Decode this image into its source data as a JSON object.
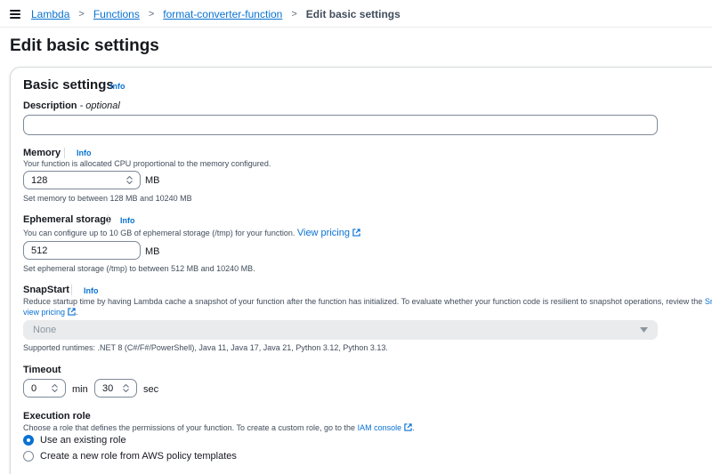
{
  "breadcrumb": {
    "items": [
      "Lambda",
      "Functions",
      "format-converter-function"
    ],
    "current": "Edit basic settings",
    "separator": ">"
  },
  "page": {
    "title": "Edit basic settings"
  },
  "basic_settings": {
    "title": "Basic settings",
    "info": "Info"
  },
  "description": {
    "label": "Description",
    "optional": " - optional",
    "value": ""
  },
  "memory": {
    "label": "Memory",
    "info": "Info",
    "help": "Your function is allocated CPU proportional to the memory configured.",
    "value": "128",
    "unit": "MB",
    "constraint": "Set memory to between 128 MB and 10240 MB"
  },
  "ephemeral": {
    "label": "Ephemeral storage",
    "info": "Info",
    "help": "You can configure up to 10 GB of ephemeral storage (/tmp) for your function.",
    "pricing_link": "View pricing",
    "value": "512",
    "unit": "MB",
    "constraint": "Set ephemeral storage (/tmp) to between 512 MB and 10240 MB."
  },
  "snapstart": {
    "label": "SnapStart",
    "info": "Info",
    "help": "Reduce startup time by having Lambda cache a snapshot of your function after the function has initialized. To evaluate whether your function code is resilient to snapshot operations, review the",
    "help_link_tail": "Sr",
    "pricing_link": "view pricing",
    "period": ".",
    "select_value": "None",
    "runtimes": "Supported runtimes: .NET 8 (C#/F#/PowerShell), Java 11, Java 17, Java 21, Python 3.12, Python 3.13."
  },
  "timeout": {
    "label": "Timeout",
    "min_value": "0",
    "min_unit": "min",
    "sec_value": "30",
    "sec_unit": "sec"
  },
  "execution_role": {
    "label": "Execution role",
    "help": "Choose a role that defines the permissions of your function. To create a custom role, go to the",
    "iam_link": "IAM console",
    "period": ".",
    "options": [
      "Use an existing role",
      "Create a new role from AWS policy templates"
    ],
    "selected_index": 0
  },
  "colors": {
    "link": "#0972d3",
    "text": "#16191f",
    "muted": "#414d5c",
    "border": "#7d8998",
    "disabled_bg": "#e9ebed"
  }
}
